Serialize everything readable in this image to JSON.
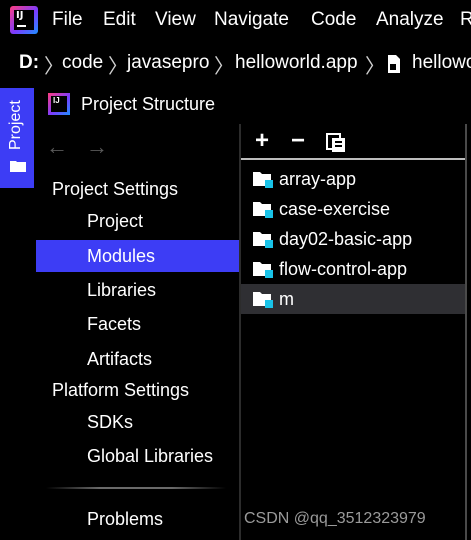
{
  "menubar": {
    "logo_text": "IJ",
    "items": [
      {
        "label": "File"
      },
      {
        "label": "Edit"
      },
      {
        "label": "View"
      },
      {
        "label": "Navigate"
      },
      {
        "label": "Code"
      },
      {
        "label": "Analyze"
      },
      {
        "label": "R"
      }
    ]
  },
  "breadcrumb": {
    "drive": "D:",
    "items": [
      "code",
      "javasepro",
      "helloworld.app",
      "hellowo"
    ]
  },
  "tool_stripe": {
    "project_tab_label": "Project"
  },
  "dialog": {
    "title": "Project Structure",
    "logo_text": "IJ",
    "back_icon": "arrow-left-icon",
    "forward_icon": "arrow-right-icon"
  },
  "sidebar": {
    "project_settings_header": "Project Settings",
    "project_settings_items": [
      {
        "label": "Project",
        "selected": false
      },
      {
        "label": "Modules",
        "selected": true
      },
      {
        "label": "Libraries",
        "selected": false
      },
      {
        "label": "Facets",
        "selected": false
      },
      {
        "label": "Artifacts",
        "selected": false
      }
    ],
    "platform_settings_header": "Platform Settings",
    "platform_settings_items": [
      {
        "label": "SDKs"
      },
      {
        "label": "Global Libraries"
      }
    ],
    "problems_label": "Problems"
  },
  "modules_panel": {
    "toolbar": {
      "add_label": "+",
      "remove_label": "−",
      "copy_icon": "copy-icon"
    },
    "modules": [
      {
        "name": "array-app",
        "selected": false
      },
      {
        "name": "case-exercise",
        "selected": false
      },
      {
        "name": "day02-basic-app",
        "selected": false
      },
      {
        "name": "flow-control-app",
        "selected": false
      },
      {
        "name": "m",
        "selected": true
      }
    ]
  },
  "watermark": "CSDN @qq_3512323979",
  "colors": {
    "accent": "#3d3df5",
    "background": "#000000",
    "selected_row": "#2f2f33",
    "module_badge": "#19c3e8"
  }
}
